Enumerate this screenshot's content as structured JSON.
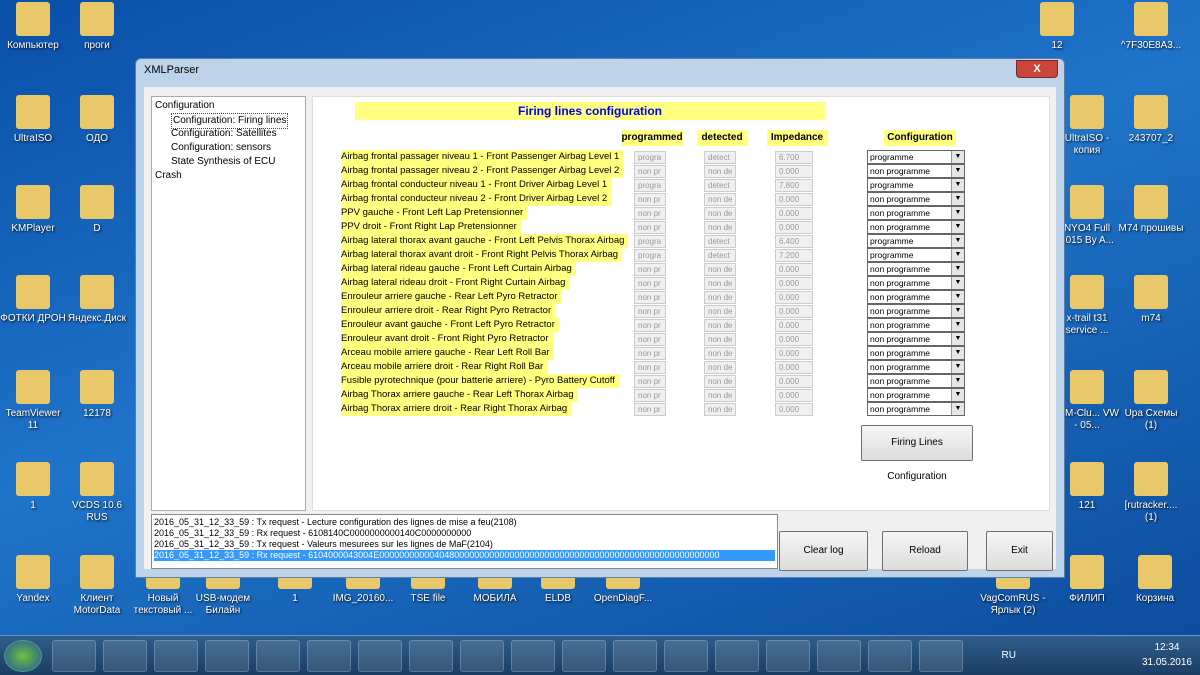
{
  "desktop": {
    "icons": [
      "Компьютер",
      "проги",
      "UltraISO",
      "ОДО",
      "KMPlayer",
      "D",
      "ФОТКИ ДРОН",
      "Яндекс.Диск",
      "TeamViewer 11",
      "12178",
      "1",
      "VCDS 10.6 RUS",
      "Yandex",
      "Клиент MotorData",
      "Новый текстовый ...",
      "USB-модем Билайн",
      "1",
      "IMG_20160...",
      "TSE file",
      "МОБИЛА",
      "ELDB",
      "OpenDiagF...",
      "VagComRUS - Ярлык (2)",
      "ФИЛИП",
      "Корзина",
      "12",
      "^7F30E8A3...",
      "UltraISO - копия",
      "243707_2",
      "NYO4 Full 2015 By A...",
      "M74 прошивы",
      "x-trail t31 service ...",
      "m74",
      "INM-Clu... VW - 05...",
      "Upa Схемы (1)",
      "121",
      "[rutracker.... (1)"
    ]
  },
  "window": {
    "title": "XMLParser",
    "close": "X"
  },
  "tree": [
    "Configuration",
    "Configuration: Firing lines",
    "Configuration: Satellites",
    "Configuration: sensors",
    "State Synthesis of ECU",
    "Crash"
  ],
  "main": {
    "title": "Firing lines configuration",
    "headers": {
      "programmed": "programmed",
      "detected": "detected",
      "impedance": "Impedance",
      "configuration": "Configuration"
    },
    "rows": [
      {
        "label": "Airbag frontal passager niveau 1 - Front Passenger Airbag Level 1",
        "programmed": "progra",
        "detected": "detect",
        "impedance": "6.700",
        "config": "programme"
      },
      {
        "label": "Airbag frontal passager niveau 2 - Front Passenger Airbag Level 2",
        "programmed": "non pr",
        "detected": "non de",
        "impedance": "0.000",
        "config": "non programme"
      },
      {
        "label": "Airbag frontal conducteur niveau 1 - Front Driver Airbag Level 1",
        "programmed": "progra",
        "detected": "detect",
        "impedance": "7.800",
        "config": "programme"
      },
      {
        "label": "Airbag frontal conducteur niveau 2 - Front Driver Airbag Level 2",
        "programmed": "non pr",
        "detected": "non de",
        "impedance": "0.000",
        "config": "non programme"
      },
      {
        "label": "PPV gauche - Front Left Lap Pretensionner",
        "programmed": "non pr",
        "detected": "non de",
        "impedance": "0.000",
        "config": "non programme"
      },
      {
        "label": "PPV droit - Front Right Lap Pretensionner",
        "programmed": "non pr",
        "detected": "non de",
        "impedance": "0.000",
        "config": "non programme"
      },
      {
        "label": "Airbag lateral thorax avant gauche - Front Left Pelvis Thorax Airbag",
        "programmed": "progra",
        "detected": "detect",
        "impedance": "6.400",
        "config": "programme"
      },
      {
        "label": "Airbag lateral thorax avant droit - Front Right Pelvis Thorax Airbag",
        "programmed": "progra",
        "detected": "detect",
        "impedance": "7.200",
        "config": "programme"
      },
      {
        "label": "Airbag lateral rideau gauche - Front Left Curtain Airbag",
        "programmed": "non pr",
        "detected": "non de",
        "impedance": "0.000",
        "config": "non programme"
      },
      {
        "label": "Airbag lateral rideau droit - Front Right Curtain Airbag",
        "programmed": "non pr",
        "detected": "non de",
        "impedance": "0.000",
        "config": "non programme"
      },
      {
        "label": "Enrouleur arriere gauche - Rear Left Pyro Retractor",
        "programmed": "non pr",
        "detected": "non de",
        "impedance": "0.000",
        "config": "non programme"
      },
      {
        "label": "Enrouleur arriere droit - Rear Right Pyro Retractor",
        "programmed": "non pr",
        "detected": "non de",
        "impedance": "0.000",
        "config": "non programme"
      },
      {
        "label": "Enrouleur avant gauche - Front Left Pyro Retractor",
        "programmed": "non pr",
        "detected": "non de",
        "impedance": "0.000",
        "config": "non programme"
      },
      {
        "label": "Enrouleur avant droit - Front Right Pyro Retractor",
        "programmed": "non pr",
        "detected": "non de",
        "impedance": "0.000",
        "config": "non programme"
      },
      {
        "label": "Arceau mobile arriere gauche - Rear Left Roll Bar",
        "programmed": "non pr",
        "detected": "non de",
        "impedance": "0.000",
        "config": "non programme"
      },
      {
        "label": "Arceau mobile arriere droit - Rear Right Roll Bar",
        "programmed": "non pr",
        "detected": "non de",
        "impedance": "0.000",
        "config": "non programme"
      },
      {
        "label": "Fusible pyrotechnique (pour batterie arriere) - Pyro Battery Cutoff",
        "programmed": "non pr",
        "detected": "non de",
        "impedance": "0.000",
        "config": "non programme"
      },
      {
        "label": "Airbag Thorax arriere gauche - Rear Left Thorax Airbag",
        "programmed": "non pr",
        "detected": "non de",
        "impedance": "0.000",
        "config": "non programme"
      },
      {
        "label": "Airbag Thorax arriere droit - Rear Right Thorax Airbag",
        "programmed": "non pr",
        "detected": "non de",
        "impedance": "0.000",
        "config": "non programme"
      }
    ],
    "firing_button": "Firing Lines Configuration"
  },
  "log": [
    "2016_05_31_12_33_59 : Tx request - Lecture configuration des lignes de mise a feu(2108)",
    "2016_05_31_12_33_59 : Rx request - 6108140C0000000000140C0000000000",
    "2016_05_31_12_33_59 : Tx request - Valeurs mesurees sur les lignes de MaF(2104)",
    "2016_05_31_12_33_59 : Rx request - 6104000043004E00000000000404800000000000000000000000000000000000000000000000000000"
  ],
  "buttons": {
    "clear": "Clear log",
    "reload": "Reload",
    "exit": "Exit"
  },
  "taskbar": {
    "lang": "RU",
    "time": "12:34",
    "date": "31.05.2016"
  }
}
